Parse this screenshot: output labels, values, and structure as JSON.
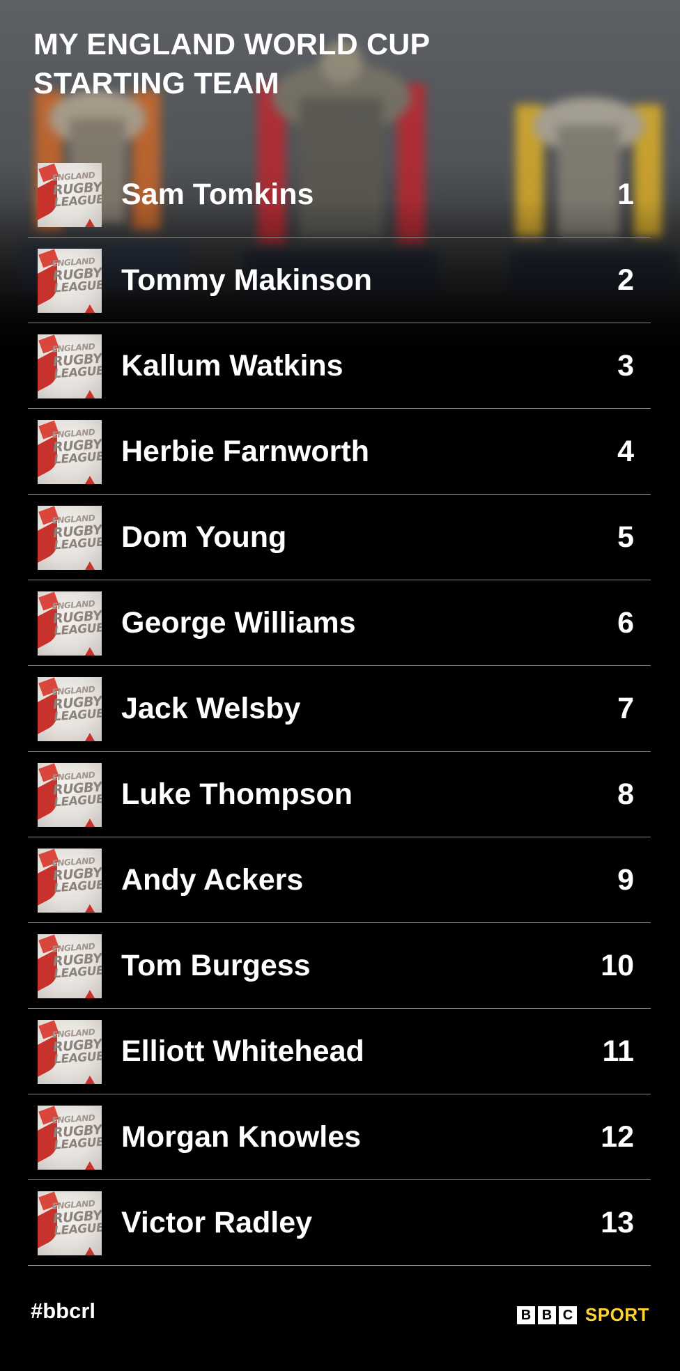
{
  "title_lines": [
    "MY ENGLAND WORLD CUP",
    "STARTING TEAM"
  ],
  "logo_text": [
    "ENGLAND",
    "RUGBY",
    "LEAGUE"
  ],
  "players": [
    {
      "name": "Sam Tomkins",
      "number": "1"
    },
    {
      "name": "Tommy Makinson",
      "number": "2"
    },
    {
      "name": "Kallum Watkins",
      "number": "3"
    },
    {
      "name": "Herbie Farnworth",
      "number": "4"
    },
    {
      "name": "Dom Young",
      "number": "5"
    },
    {
      "name": "George Williams",
      "number": "6"
    },
    {
      "name": "Jack Welsby",
      "number": "7"
    },
    {
      "name": "Luke Thompson",
      "number": "8"
    },
    {
      "name": "Andy Ackers",
      "number": "9"
    },
    {
      "name": "Tom Burgess",
      "number": "10"
    },
    {
      "name": "Elliott Whitehead",
      "number": "11"
    },
    {
      "name": "Morgan Knowles",
      "number": "12"
    },
    {
      "name": "Victor Radley",
      "number": "13"
    }
  ],
  "footer": {
    "hashtag": "#bbcrl",
    "brand_letters": [
      "B",
      "B",
      "C"
    ],
    "brand_sport": "SPORT"
  },
  "colors": {
    "background": "#000000",
    "divider": "#8a8a8a",
    "brand_accent": "#ffd230",
    "logo_red": "#c8322d"
  },
  "icons": {
    "row_badge": "england-rugby-league-ball-icon",
    "background": "world-cup-trophies-photo"
  }
}
